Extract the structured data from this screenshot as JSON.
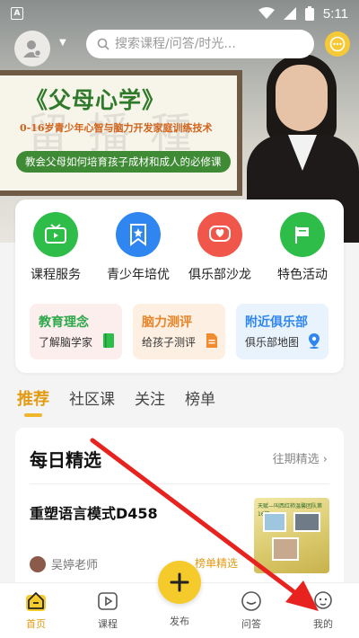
{
  "status_bar": {
    "left_badge": "A",
    "time": "5:11"
  },
  "header": {
    "search_placeholder": "搜索课程/问答/时光..."
  },
  "banner": {
    "title": "《父母心学》",
    "subtitle": "0-16岁青少年心智与脑力开发家庭训练技术",
    "tagline": "教会父母如何培育孩子成材和成人的必修课",
    "board_bg_text": "留 播 種"
  },
  "quick_menu": {
    "items": [
      {
        "label": "课程服务",
        "icon": "tv-icon",
        "color": "#2fbd4a"
      },
      {
        "label": "青少年培优",
        "icon": "star-bookmark-icon",
        "color": "#2f86f0"
      },
      {
        "label": "俱乐部沙龙",
        "icon": "heart-chat-icon",
        "color": "#f0574a"
      },
      {
        "label": "特色活动",
        "icon": "flag-icon",
        "color": "#2fbd4a"
      }
    ],
    "cards": [
      {
        "title": "教育理念",
        "subtitle": "了解脑学家",
        "title_color": "#2da84a",
        "bg": "#fbeeed",
        "icon": "book-icon"
      },
      {
        "title": "脑力测评",
        "subtitle": "给孩子测评",
        "title_color": "#e8842a",
        "bg": "#fdf0e2",
        "icon": "document-icon"
      },
      {
        "title": "附近俱乐部",
        "subtitle": "俱乐部地图",
        "title_color": "#2f86f0",
        "bg": "#e9f3fd",
        "icon": "location-pin-icon"
      }
    ]
  },
  "tabs": [
    "推荐",
    "社区课",
    "关注",
    "榜单"
  ],
  "feed": {
    "section_title": "每日精选",
    "more_label": "往期精选",
    "course_title": "重塑语言模式D458",
    "author": "吴婷老师",
    "badge": "榜单精选",
    "thumb_caption": "天赋—叫西红柿温馨团队第16期"
  },
  "bottom_nav": [
    {
      "label": "首页",
      "icon": "home-icon",
      "active": true
    },
    {
      "label": "课程",
      "icon": "play-icon",
      "active": false
    },
    {
      "label": "发布",
      "icon": "plus-icon",
      "active": false
    },
    {
      "label": "问答",
      "icon": "chat-face-icon",
      "active": false
    },
    {
      "label": "我的",
      "icon": "profile-face-icon",
      "active": false
    }
  ],
  "colors": {
    "accent": "#f5cb2b",
    "active": "#e29b14",
    "arrow": "#e8231f"
  }
}
